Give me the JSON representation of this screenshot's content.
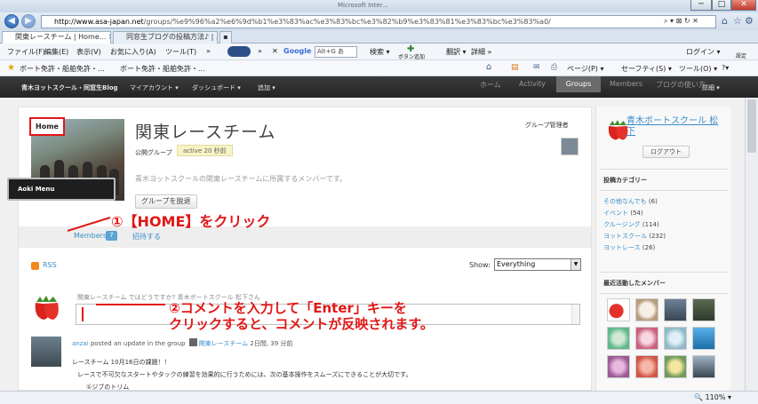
{
  "window": {
    "title": "Microsoft Inter...",
    "btn_min": "─",
    "btn_max": "□",
    "btn_close": "✕"
  },
  "browser": {
    "url_host": "http://www.asa-japan.net",
    "url_path": "/groups/%e9%96%a2%e6%9d%b1%e3%83%ac%e3%83%bc%e3%82%b9%e3%83%81%e3%83%bc%e3%83%a0/",
    "addr_tools": "⌕ ▾ ⊠ ↻ ✕",
    "tabs": [
      "関東レースチーム | Home... ✕",
      "同窓生ブログの投稿方法♪ | ..."
    ],
    "menu": [
      "ファイル(F)",
      "編集(E)",
      "表示(V)",
      "お気に入り(A)",
      "ツール(T)",
      "»",
      "✕",
      "Google",
      "Alt+G ▾",
      "検索 ▾",
      "ボタン追加",
      "翻訳 ▾",
      "詳細 »",
      "ログイン ▾",
      "設定"
    ],
    "google_input": "Alt+G あ",
    "favorites": [
      "ボート免許・船舶免許・...",
      "ボート免許・船舶免許・..."
    ],
    "commands": [
      "ページ(P) ▾",
      "セーフティ(S) ▾",
      "ツール(O) ▾",
      "?▾"
    ]
  },
  "wpbar": {
    "site": "青木ヨットスクール・同窓生Blog",
    "account": "マイアカウント ▾",
    "dashboard": "ダッシュボード ▾",
    "new": "追加 ▾",
    "nav": [
      "ホーム",
      "Activity",
      "Groups",
      "Members",
      "ブログの使い方"
    ],
    "extra": "詳細 ▾"
  },
  "group": {
    "title": "関東レースチーム",
    "public": "公開グループ",
    "active": "active 20 秒前",
    "description": "青木ヨットスクールの関東レースチームに所属するメンバーです。",
    "send_button": "グループを脱退",
    "admin_label": "グループ管理者"
  },
  "aoki_menu": "Aoki Menu",
  "subnav": {
    "home": "Home",
    "members": "Members",
    "members_count": "7",
    "invite": "招待する"
  },
  "feed": {
    "rss": "RSS",
    "show_label": "Show:",
    "show_value": "Everything",
    "whats_new": "関東レースチーム ではどうですか? 青木ボートスクール 松下さん"
  },
  "activity": {
    "user": "anzai",
    "action": " posted an update in the group ",
    "group": "関東レースチーム",
    "time": " 2日間, 39 分前",
    "line1": "レースチーム 10月16日の課題！！",
    "line2": "レースで不可欠なスタートやタックの練習を効果的に行うためには、次の基本操作をスムーズにできることが大切です。",
    "line3": "①ジブのトリム"
  },
  "annotations": {
    "step1": "①【HOME】をクリック",
    "step2_a": "②コメントを入力して「Enter」キーを",
    "step2_b": "クリックすると、コメントが反映されます。"
  },
  "sidebar": {
    "user_name": "青木ボートスクール 松下",
    "logout": "ログアウト",
    "categories_title": "投稿カテゴリー",
    "categories": [
      {
        "label": "その他なんでも",
        "count": "(6)"
      },
      {
        "label": "イベント",
        "count": "(54)"
      },
      {
        "label": "クルージング",
        "count": "(114)"
      },
      {
        "label": "ヨットスクール",
        "count": "(232)"
      },
      {
        "label": "ヨットレース",
        "count": "(26)"
      }
    ],
    "recent_title": "最近活動したメンバー"
  },
  "statusbar": {
    "zoom": "🔍 110%  ▾"
  },
  "colors": {
    "annotation_red": "#e21616",
    "link_blue": "#3a8ec7",
    "admin_bar": "#2f2f2f"
  }
}
